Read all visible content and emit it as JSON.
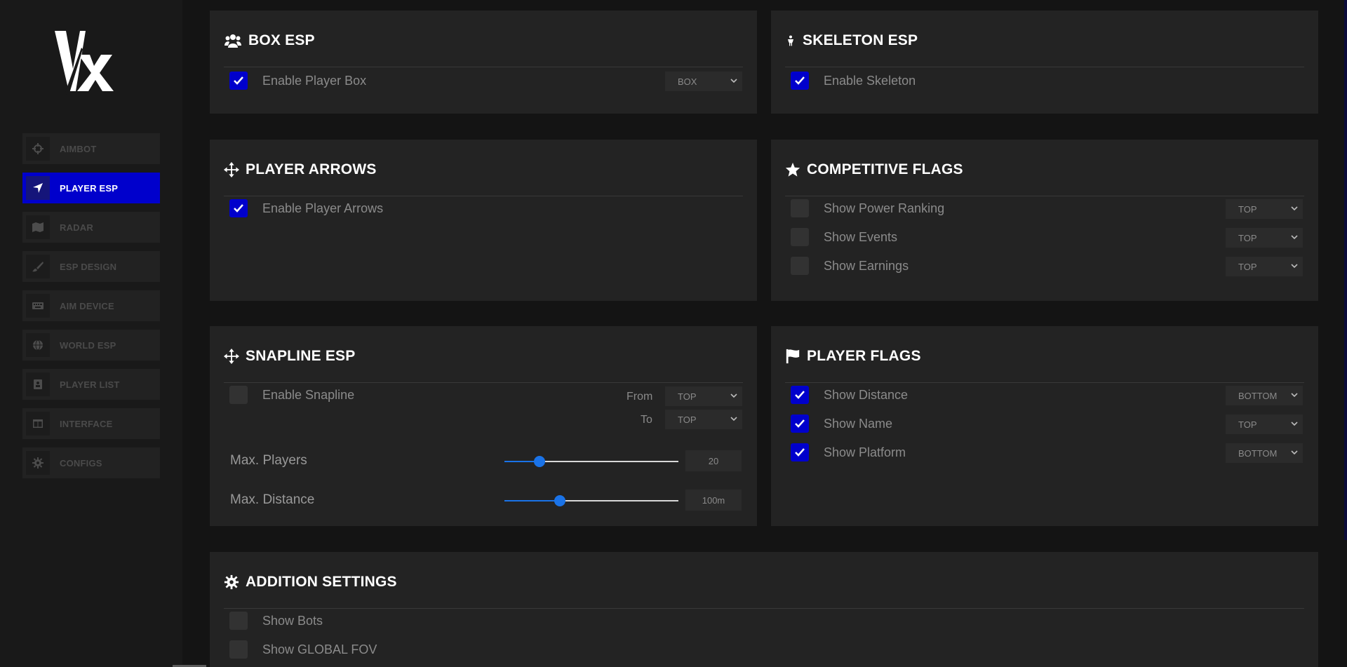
{
  "app": {
    "logo_text": "VX"
  },
  "sidebar": {
    "items": [
      {
        "label": "AIMBOT",
        "icon": "crosshair-icon",
        "active": false
      },
      {
        "label": "PLAYER ESP",
        "icon": "location-arrow-icon",
        "active": true
      },
      {
        "label": "RADAR",
        "icon": "map-icon",
        "active": false
      },
      {
        "label": "ESP DESIGN",
        "icon": "brush-icon",
        "active": false
      },
      {
        "label": "AIM DEVICE",
        "icon": "keyboard-icon",
        "active": false
      },
      {
        "label": "WORLD ESP",
        "icon": "globe-icon",
        "active": false
      },
      {
        "label": "PLAYER LIST",
        "icon": "address-book-icon",
        "active": false
      },
      {
        "label": "INTERFACE",
        "icon": "window-icon",
        "active": false
      },
      {
        "label": "CONFIGS",
        "icon": "gear-icon",
        "active": false
      }
    ]
  },
  "colors": {
    "accent": "#0000cc",
    "slider": "#1a73e8",
    "panel": "#232323",
    "background": "#141414"
  },
  "box_esp": {
    "title": "BOX ESP",
    "icon": "users-icon",
    "enable_label": "Enable Player Box",
    "enabled": true,
    "style_value": "BOX"
  },
  "skeleton_esp": {
    "title": "SKELETON ESP",
    "icon": "child-icon",
    "enable_label": "Enable Skeleton",
    "enabled": true
  },
  "player_arrows": {
    "title": "PLAYER ARROWS",
    "icon": "arrows-move-icon",
    "enable_label": "Enable Player Arrows",
    "enabled": true
  },
  "competitive_flags": {
    "title": "COMPETITIVE FLAGS",
    "icon": "star-icon",
    "rows": [
      {
        "label": "Show Power Ranking",
        "checked": false,
        "position": "TOP"
      },
      {
        "label": "Show Events",
        "checked": false,
        "position": "TOP"
      },
      {
        "label": "Show Earnings",
        "checked": false,
        "position": "TOP"
      }
    ]
  },
  "snapline_esp": {
    "title": "SNAPLINE ESP",
    "icon": "arrows-move-icon",
    "enable_label": "Enable Snapline",
    "enabled": false,
    "from_label": "From",
    "from_value": "TOP",
    "to_label": "To",
    "to_value": "TOP",
    "max_players_label": "Max. Players",
    "max_players_value": "20",
    "max_players_fraction": 0.2,
    "max_distance_label": "Max. Distance",
    "max_distance_value": "100m",
    "max_distance_fraction": 0.32
  },
  "player_flags": {
    "title": "PLAYER FLAGS",
    "icon": "flag-icon",
    "rows": [
      {
        "label": "Show Distance",
        "checked": true,
        "position": "BOTTOM"
      },
      {
        "label": "Show Name",
        "checked": true,
        "position": "TOP"
      },
      {
        "label": "Show Platform",
        "checked": true,
        "position": "BOTTOM"
      }
    ]
  },
  "addition_settings": {
    "title": "ADDITION SETTINGS",
    "icon": "gear-icon",
    "rows": [
      {
        "label": "Show Bots",
        "checked": false
      },
      {
        "label": "Show GLOBAL FOV",
        "checked": false
      }
    ]
  }
}
